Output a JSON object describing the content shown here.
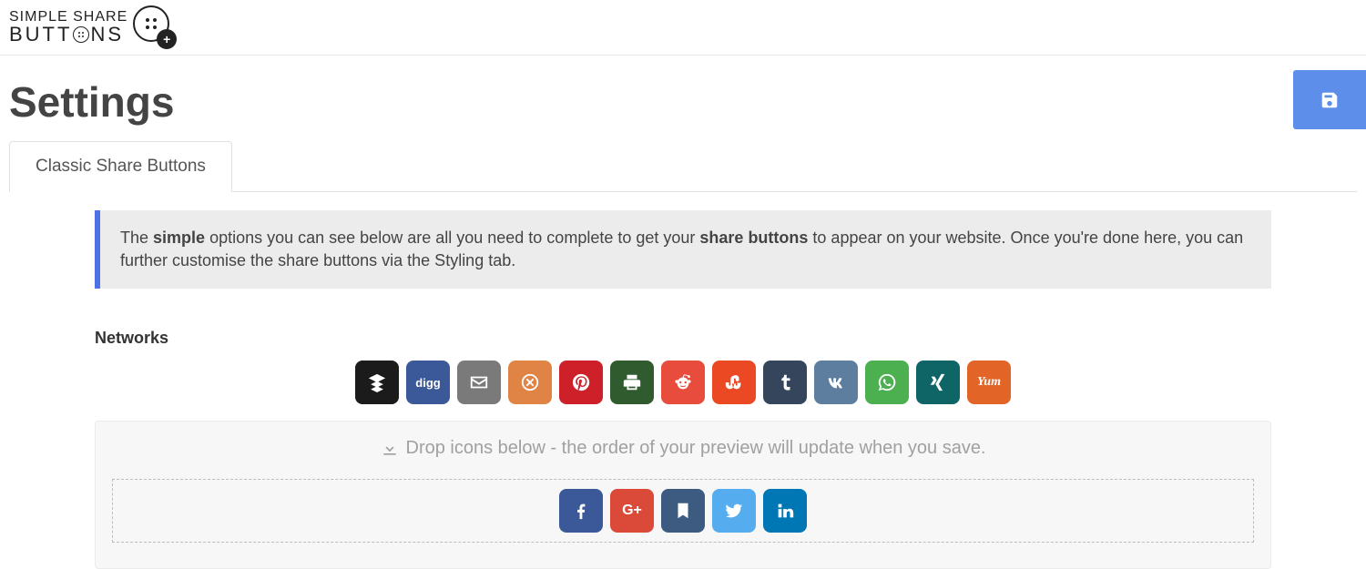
{
  "brand": {
    "line1": "SIMPLE SHARE",
    "line2_prefix": "BUTT",
    "line2_suffix": "NS"
  },
  "page": {
    "title": "Settings"
  },
  "tabs": [
    {
      "label": "Classic Share Buttons"
    }
  ],
  "info": {
    "prefix": "The ",
    "bold1": "simple",
    "mid": " options you can see below are all you need to complete to get your ",
    "bold2": "share buttons",
    "suffix": " to appear on your website. Once you're done here, you can further customise the share buttons via the Styling tab."
  },
  "section": {
    "networks_label": "Networks"
  },
  "drop": {
    "caption": "Drop icons below - the order of your preview will update when you save."
  },
  "available_networks": [
    {
      "id": "buffer",
      "label": "Buffer"
    },
    {
      "id": "digg",
      "label": "Digg"
    },
    {
      "id": "email",
      "label": "Email"
    },
    {
      "id": "flipboard",
      "label": "Flipboard"
    },
    {
      "id": "pinterest",
      "label": "Pinterest"
    },
    {
      "id": "print",
      "label": "Print"
    },
    {
      "id": "reddit",
      "label": "Reddit"
    },
    {
      "id": "stumble",
      "label": "StumbleUpon"
    },
    {
      "id": "tumblr",
      "label": "Tumblr"
    },
    {
      "id": "vk",
      "label": "VK"
    },
    {
      "id": "whatsapp",
      "label": "WhatsApp"
    },
    {
      "id": "xing",
      "label": "Xing"
    },
    {
      "id": "yummly",
      "label": "Yummly"
    }
  ],
  "selected_networks": [
    {
      "id": "facebook",
      "label": "Facebook"
    },
    {
      "id": "google",
      "label": "Google+"
    },
    {
      "id": "pocket",
      "label": "Pocket"
    },
    {
      "id": "twitter",
      "label": "Twitter"
    },
    {
      "id": "linkedin",
      "label": "LinkedIn"
    }
  ],
  "icon_text": {
    "digg": "digg",
    "yummly": "Yum",
    "google": "G+"
  }
}
